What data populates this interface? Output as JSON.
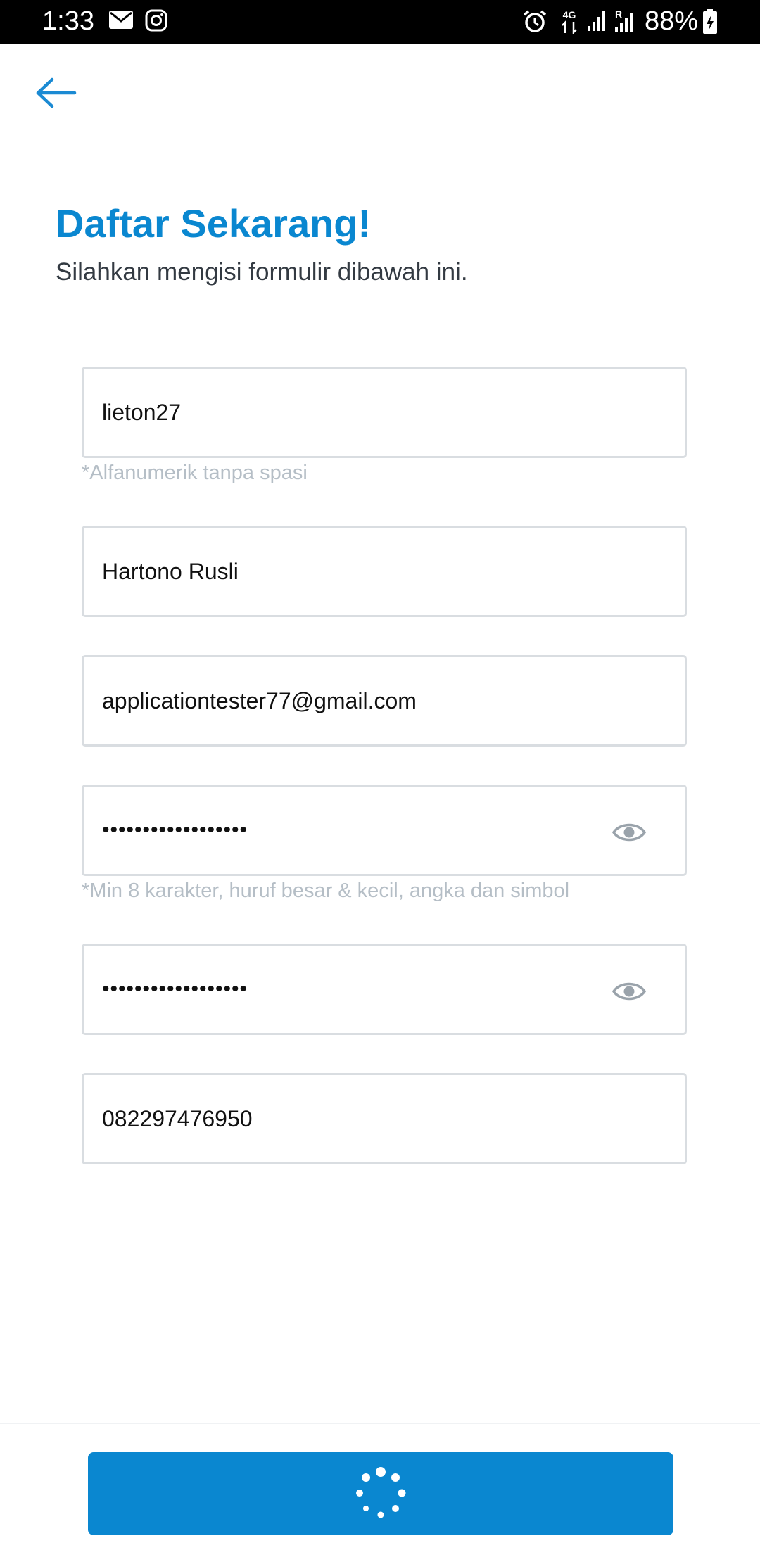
{
  "status_bar": {
    "time": "1:33",
    "network": "4G",
    "roaming": "R",
    "battery": "88%",
    "icons": [
      "email-icon",
      "instagram-icon",
      "alarm-icon",
      "data-arrows-icon",
      "signal-icon",
      "signal-roaming-icon",
      "battery-charging-icon"
    ]
  },
  "header": {
    "back_icon": "arrow-left-icon",
    "title": "Daftar Sekarang!",
    "subtitle": "Silahkan mengisi formulir dibawah ini."
  },
  "form": {
    "username": {
      "value": "lieton27",
      "hint": "*Alfanumerik tanpa spasi"
    },
    "full_name": {
      "value": "Hartono Rusli"
    },
    "email": {
      "value": "applicationtester77@gmail.com"
    },
    "password": {
      "value": "••••••••••••••••••",
      "hint": "*Min 8 karakter, huruf besar & kecil, angka dan simbol",
      "toggle_icon": "eye-icon"
    },
    "confirm_password": {
      "value": "••••••••••••••••••",
      "toggle_icon": "eye-icon"
    },
    "phone": {
      "value": "082297476950"
    }
  },
  "submit": {
    "state": "loading",
    "icon": "spinner-icon"
  },
  "colors": {
    "accent": "#0a87d0",
    "hint": "#b5bec6",
    "border": "#d9dde1",
    "text": "#333a42"
  }
}
